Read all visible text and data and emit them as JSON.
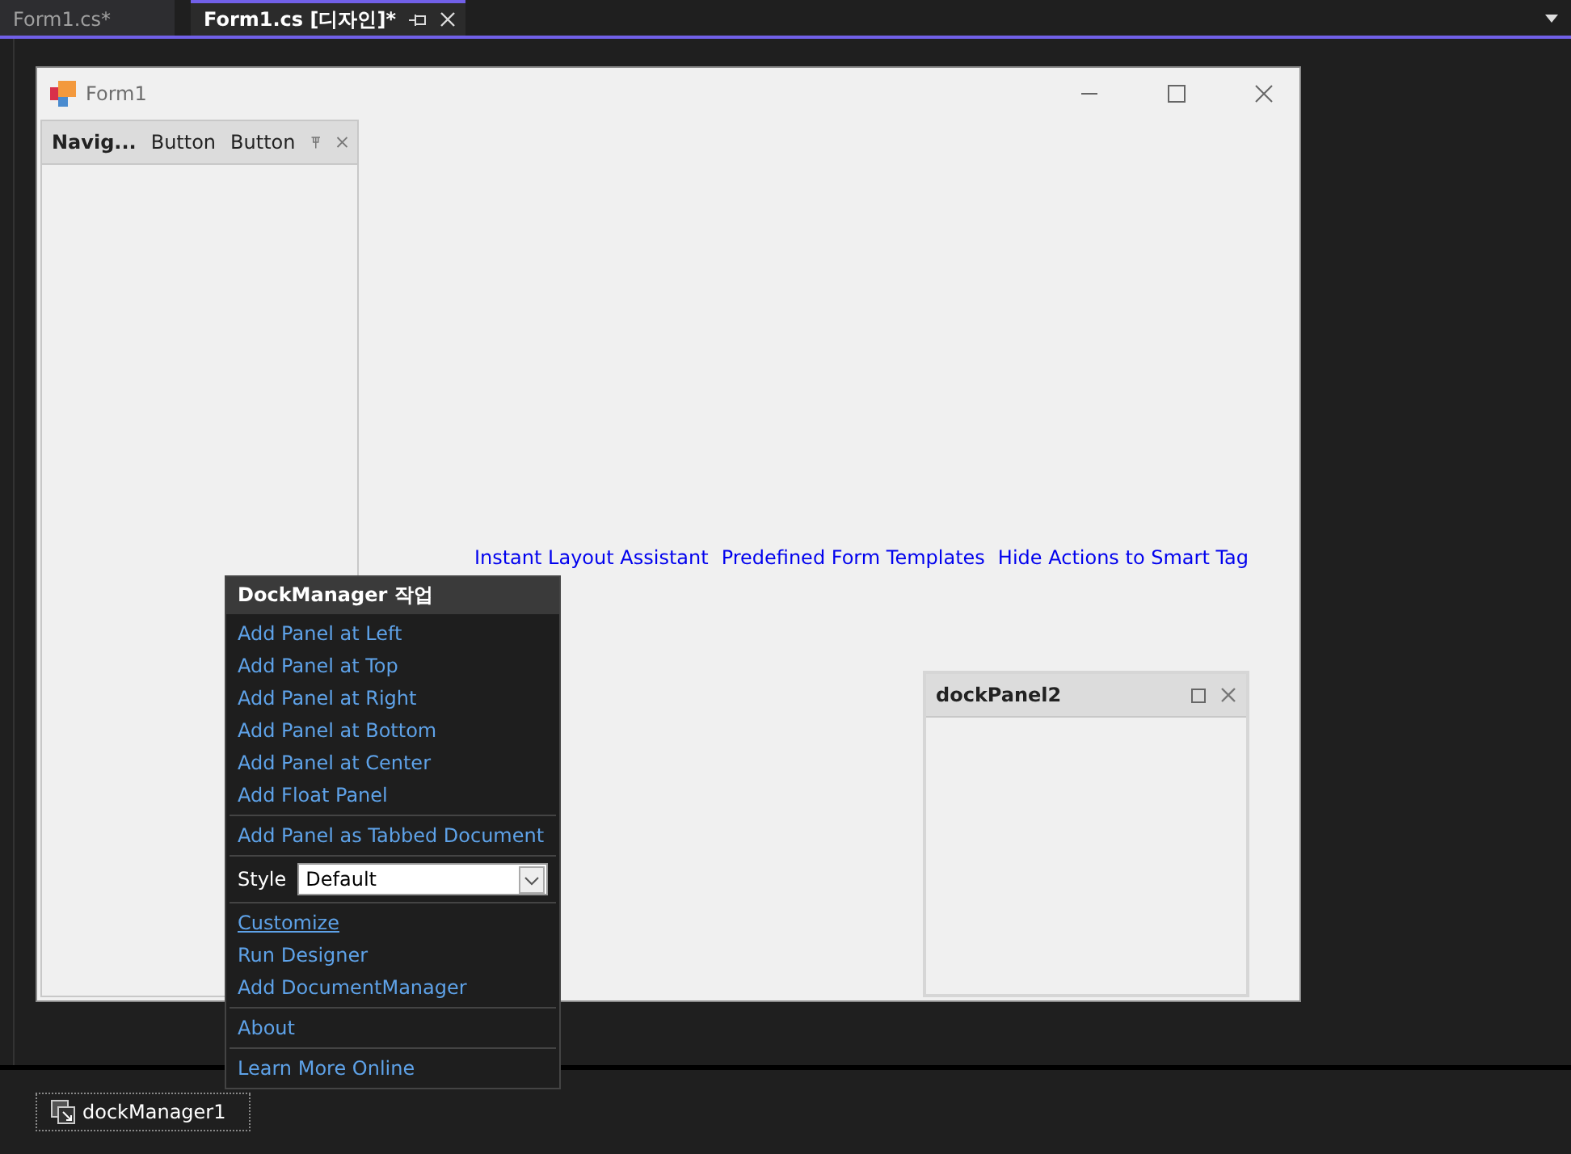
{
  "tabs": [
    {
      "label": "Form1.cs*",
      "selected": false
    },
    {
      "label": "Form1.cs [디자인]*",
      "selected": true
    }
  ],
  "form": {
    "title": "Form1",
    "nav_panel": {
      "title": "Navig...",
      "buttons": [
        "Button",
        "Button"
      ]
    },
    "designer_links": [
      "Instant Layout Assistant",
      "Predefined Form Templates",
      "Hide Actions to Smart Tag"
    ],
    "float_panel": {
      "title": "dockPanel2"
    }
  },
  "smart_tag": {
    "title": "DockManager 작업",
    "groups": [
      [
        {
          "kind": "action",
          "label": "Add Panel at Left"
        },
        {
          "kind": "action",
          "label": "Add Panel at Top"
        },
        {
          "kind": "action",
          "label": "Add Panel at Right"
        },
        {
          "kind": "action",
          "label": "Add Panel at Bottom"
        },
        {
          "kind": "action",
          "label": "Add Panel at Center"
        },
        {
          "kind": "action",
          "label": "Add Float Panel"
        }
      ],
      [
        {
          "kind": "action",
          "label": "Add Panel as Tabbed Document"
        }
      ],
      [
        {
          "kind": "select",
          "label": "Style",
          "value": "Default"
        }
      ],
      [
        {
          "kind": "link",
          "label": "Customize"
        },
        {
          "kind": "action",
          "label": "Run Designer"
        },
        {
          "kind": "action",
          "label": "Add DocumentManager"
        }
      ],
      [
        {
          "kind": "action",
          "label": "About"
        }
      ],
      [
        {
          "kind": "action",
          "label": "Learn More Online"
        }
      ]
    ]
  },
  "component_tray": [
    {
      "label": "dockManager1"
    }
  ]
}
